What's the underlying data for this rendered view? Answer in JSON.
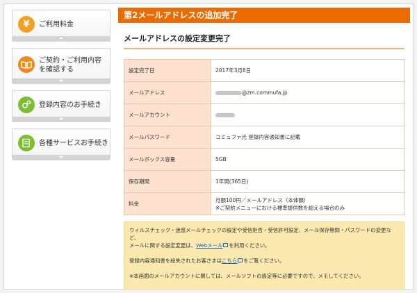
{
  "sidebar": {
    "items": [
      {
        "label": "ご利用料金",
        "icon": "yen-icon",
        "color": "#f4a020"
      },
      {
        "label": "ご契約・ご利用内容を確認する",
        "icon": "book-icon",
        "color": "#ee8a1a"
      },
      {
        "label": "登録内容のお手続き",
        "icon": "gears-icon",
        "color": "#7cbf2e"
      },
      {
        "label": "各種サービスお手続き",
        "icon": "form-icon",
        "color": "#7cbf2e"
      }
    ]
  },
  "main": {
    "page_title": "第2メールアドレスの追加完了",
    "section_title": "メールアドレスの設定変更完了",
    "rows": [
      {
        "label": "設定完了日",
        "value": "2017年3月8日"
      },
      {
        "label": "メールアドレス",
        "value": "@zm.commufa.jp"
      },
      {
        "label": "メールアカウント",
        "value": ""
      },
      {
        "label": "メールパスワード",
        "value": "コミュファ光 登録内容通知書に記載"
      },
      {
        "label": "メールボックス容量",
        "value": "5GB"
      },
      {
        "label": "保存期間",
        "value": "1年間(365日)"
      },
      {
        "label": "料金",
        "value": "月額100円／メールアドレス（本体額）",
        "value2": "※ご契約メニューにおける標準提供数を超える場合のみ"
      }
    ],
    "notice": {
      "line1": "ウィルスチェック・迷惑メールチェックの設定や受信拒否・受信許可設定、メール保存期間・パスワードの変更など、",
      "line2_pre": "メールに関する設定変更は、",
      "line2_link": "Webメール",
      "line2_post": "を利用ください。",
      "line3_pre": "登録内容通知書を紛失されたお客さまは",
      "line3_link": "こちら",
      "line3_post": "をご覧ください。",
      "line4": "※本画面のメールアカウントに関しては、メールソフトの設定等に必要ですので、メモしてください。"
    }
  },
  "colors": {
    "accent": "#ec6b00",
    "table_header": "#fde2cf",
    "notice_bg": "#fce9b0",
    "link": "#1a5fb4"
  }
}
